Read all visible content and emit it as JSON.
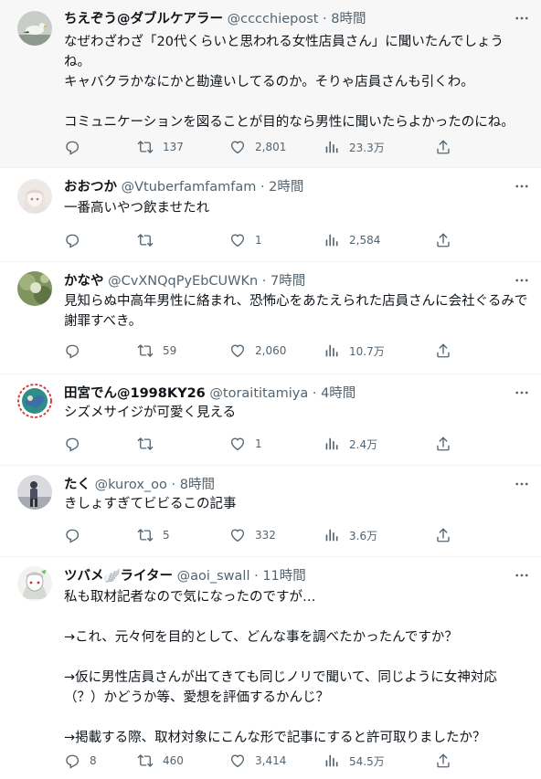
{
  "tweets": [
    {
      "name": "ちえぞう@ダブルケアラー",
      "handle": "@cccchiepost",
      "time": "8時間",
      "body": "なぜわざわざ「20代くらいと思われる女性店員さん」に聞いたんでしょうね。\nキャバクラかなにかと勘違いしてるのか。そりゃ店員さんも引くわ。\n\nコミュニケーションを図ることが目的なら男性に聞いたらよかったのにね。",
      "replies": "",
      "retweets": "137",
      "likes": "2,801",
      "views": "23.3万"
    },
    {
      "name": "おおつか",
      "handle": "@Vtuberfamfamfam",
      "time": "2時間",
      "body": "一番高いやつ飲ませたれ",
      "replies": "",
      "retweets": "",
      "likes": "1",
      "views": "2,584"
    },
    {
      "name": "かなや",
      "handle": "@CvXNQqPyEbCUWKn",
      "time": "7時間",
      "body": "見知らぬ中高年男性に絡まれ、恐怖心をあたえられた店員さんに会社ぐるみで謝罪すべき。",
      "replies": "",
      "retweets": "59",
      "likes": "2,060",
      "views": "10.7万"
    },
    {
      "name": "田宮でん@1998KY26",
      "handle": "@toraititamiya",
      "time": "4時間",
      "body": "シズメサイジが可愛く見える",
      "replies": "",
      "retweets": "",
      "likes": "1",
      "views": "2.4万"
    },
    {
      "name": "たく",
      "handle": "@kurox_oo",
      "time": "8時間",
      "body": "きしょすぎてビビるこの記事",
      "replies": "",
      "retweets": "5",
      "likes": "332",
      "views": "3.6万"
    },
    {
      "name": "ツバメ🪽ライター",
      "handle": "@aoi_swall",
      "time": "11時間",
      "body": "私も取材記者なので気になったのですが…\n\n→これ、元々何を目的として、どんな事を調べたかったんですか？\n\n→仮に男性店員さんが出てきても同じノリで聞いて、同じように女神対応（？）かどうか等、愛想を評価するかんじ？\n\n→掲載する際、取材対象にこんな形で記事にすると許可取りましたか？",
      "replies": "8",
      "retweets": "460",
      "likes": "3,414",
      "views": "54.5万"
    }
  ],
  "separator": " · ",
  "icons": {
    "reply": "reply-icon",
    "retweet": "retweet-icon",
    "like": "heart-icon",
    "views": "views-icon",
    "share": "share-icon",
    "more": "more-icon"
  },
  "colors": {
    "text": "#0f1419",
    "secondary": "#536471",
    "border": "#eff3f4",
    "highlight_bg": "#f7f7f7"
  }
}
